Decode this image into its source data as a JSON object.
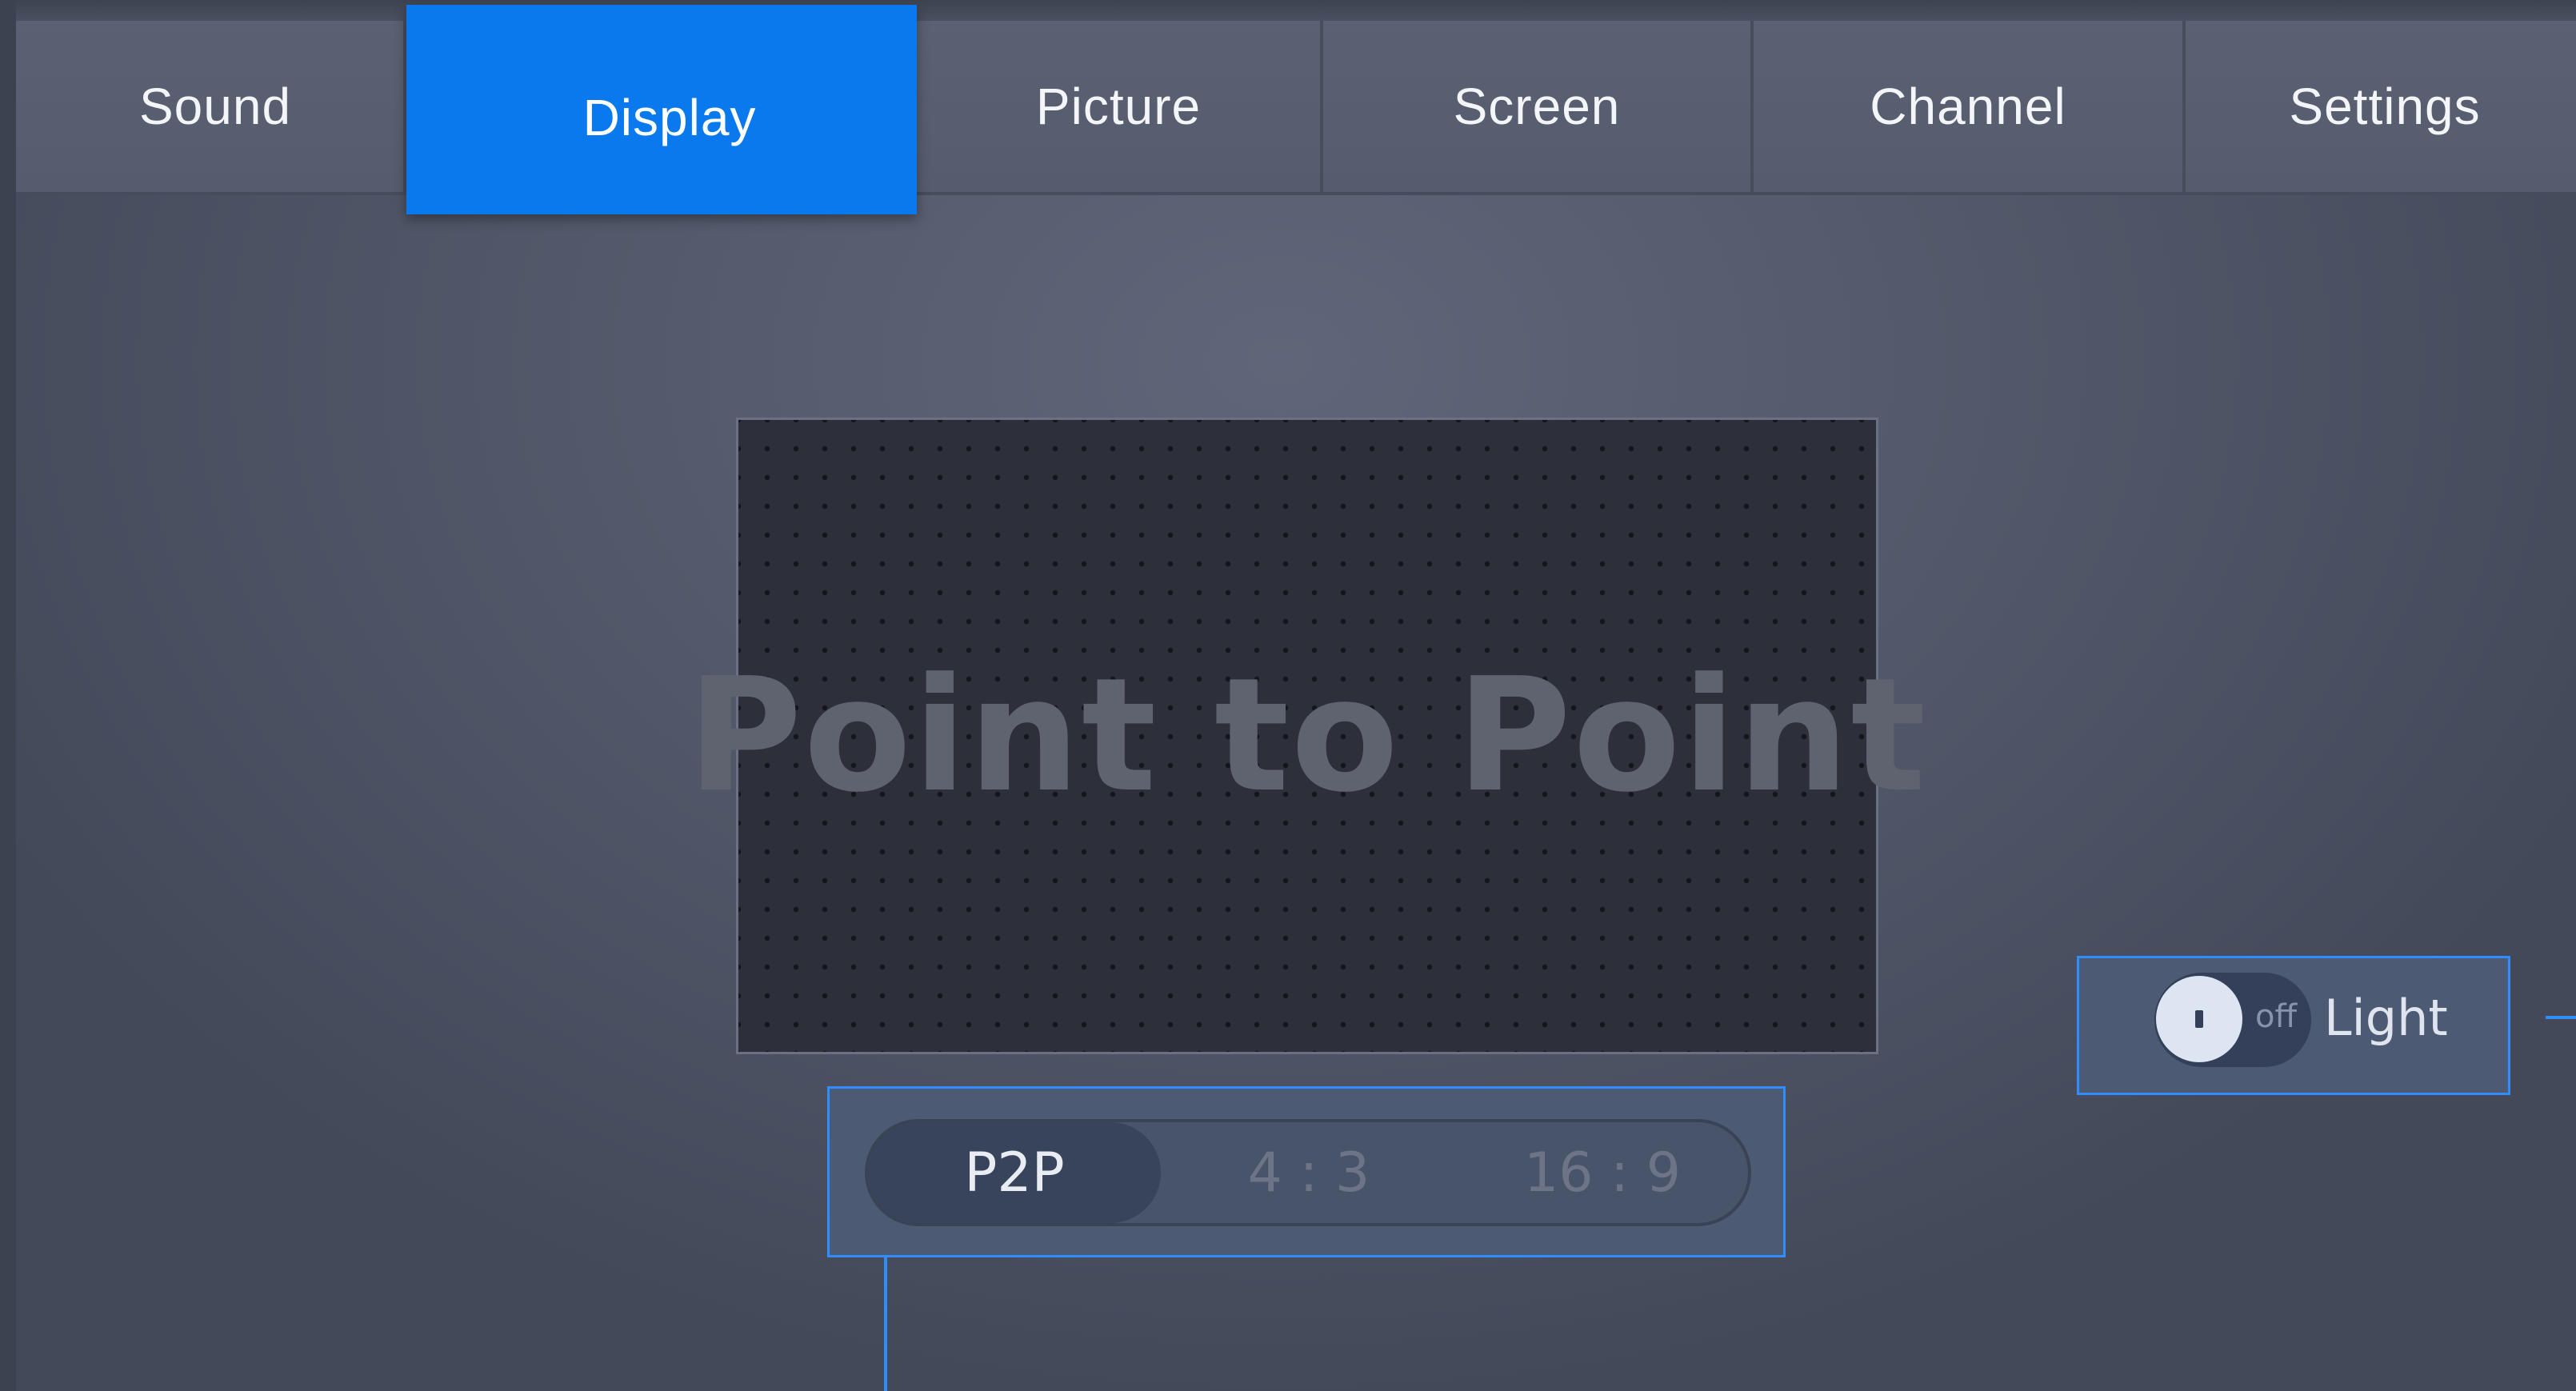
{
  "tabs": [
    {
      "label": "Sound",
      "active": false
    },
    {
      "label": "Display",
      "active": true
    },
    {
      "label": "Picture",
      "active": false
    },
    {
      "label": "Screen",
      "active": false
    },
    {
      "label": "Channel",
      "active": false
    },
    {
      "label": "Settings",
      "active": false
    }
  ],
  "preview": {
    "text": "Point to Point"
  },
  "aspect_ratio": {
    "options": [
      "P2P",
      "4 : 3",
      "16 : 9"
    ],
    "selected": "P2P"
  },
  "light_toggle": {
    "state": "off",
    "label": "Light"
  },
  "colors": {
    "accent": "#0b79ee",
    "focus_border": "#2f8dff"
  }
}
